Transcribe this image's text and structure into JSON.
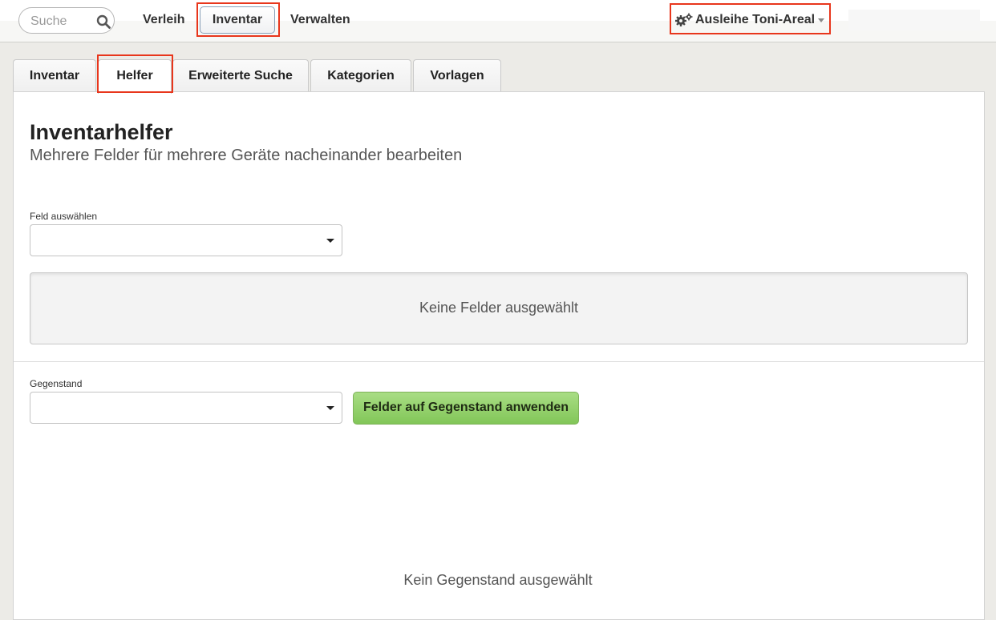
{
  "topbar": {
    "search_placeholder": "Suche",
    "nav": {
      "verleih": "Verleih",
      "inventar": "Inventar",
      "verwalten": "Verwalten"
    },
    "pool_label": "Ausleihe Toni-Areal"
  },
  "tabs": [
    "Inventar",
    "Helfer",
    "Erweiterte Suche",
    "Kategorien",
    "Vorlagen"
  ],
  "active_tab": "Helfer",
  "page": {
    "title": "Inventarhelfer",
    "subtitle": "Mehrere Felder für mehrere Geräte nacheinander bearbeiten"
  },
  "field_select": {
    "label": "Feld auswählen",
    "value": ""
  },
  "fields_empty_text": "Keine Felder ausgewählt",
  "item_select": {
    "label": "Gegenstand",
    "value": ""
  },
  "apply_button": "Felder auf Gegenstand anwenden",
  "item_empty_text": "Kein Gegenstand ausgewählt",
  "colors": {
    "highlight": "#e8361c",
    "apply_button": "#8fcd66",
    "background": "#ecebe7"
  }
}
